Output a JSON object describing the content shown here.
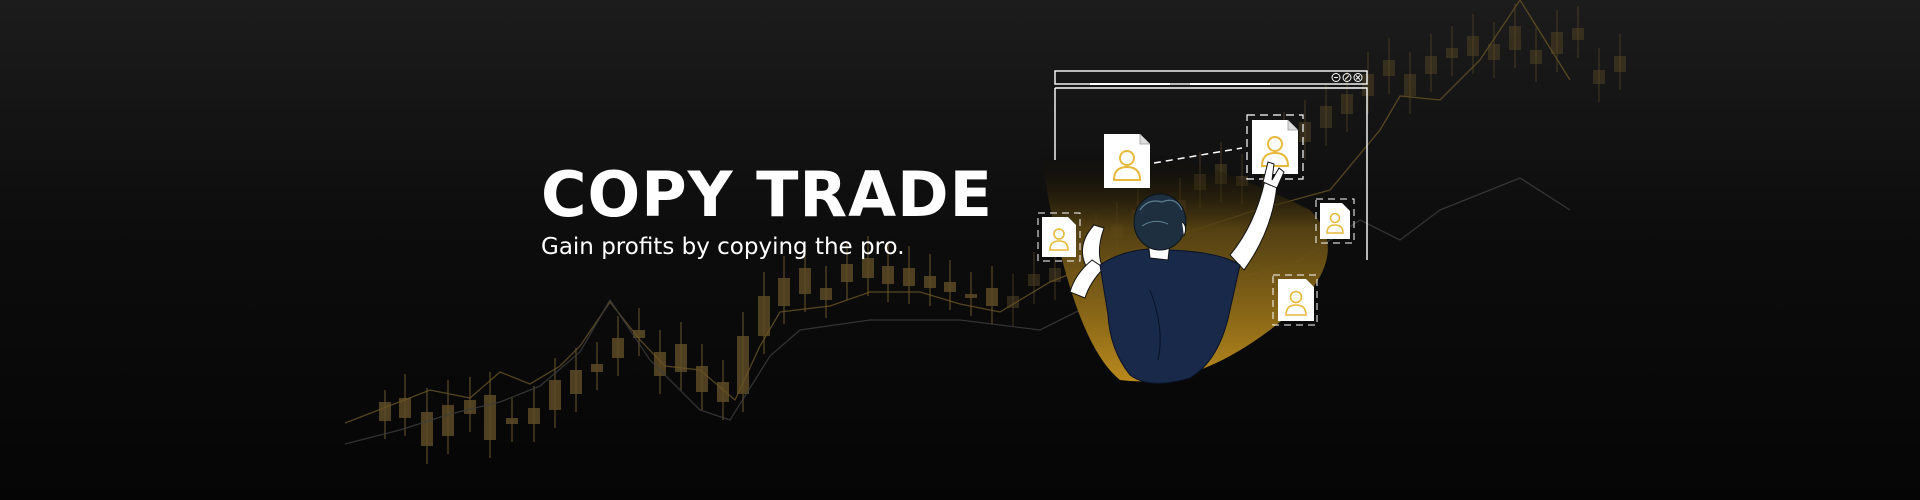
{
  "hero": {
    "title": "COPY TRADE",
    "subtitle": "Gain profits by copying the pro."
  },
  "colors": {
    "background_top": "#1d1c1c",
    "background_bottom": "#050505",
    "accent_gold": "#e6b93a",
    "candle_dim": "#5c4a26",
    "shirt_navy": "#18294a",
    "text": "#ffffff"
  },
  "illustration": {
    "window_controls": [
      "minimize-icon",
      "edit-icon",
      "close-icon"
    ],
    "profile_cards": [
      "user-profile-card",
      "user-profile-card-selected",
      "user-profile-card",
      "user-profile-card",
      "user-profile-card"
    ],
    "figure": "person-selecting-trader"
  }
}
